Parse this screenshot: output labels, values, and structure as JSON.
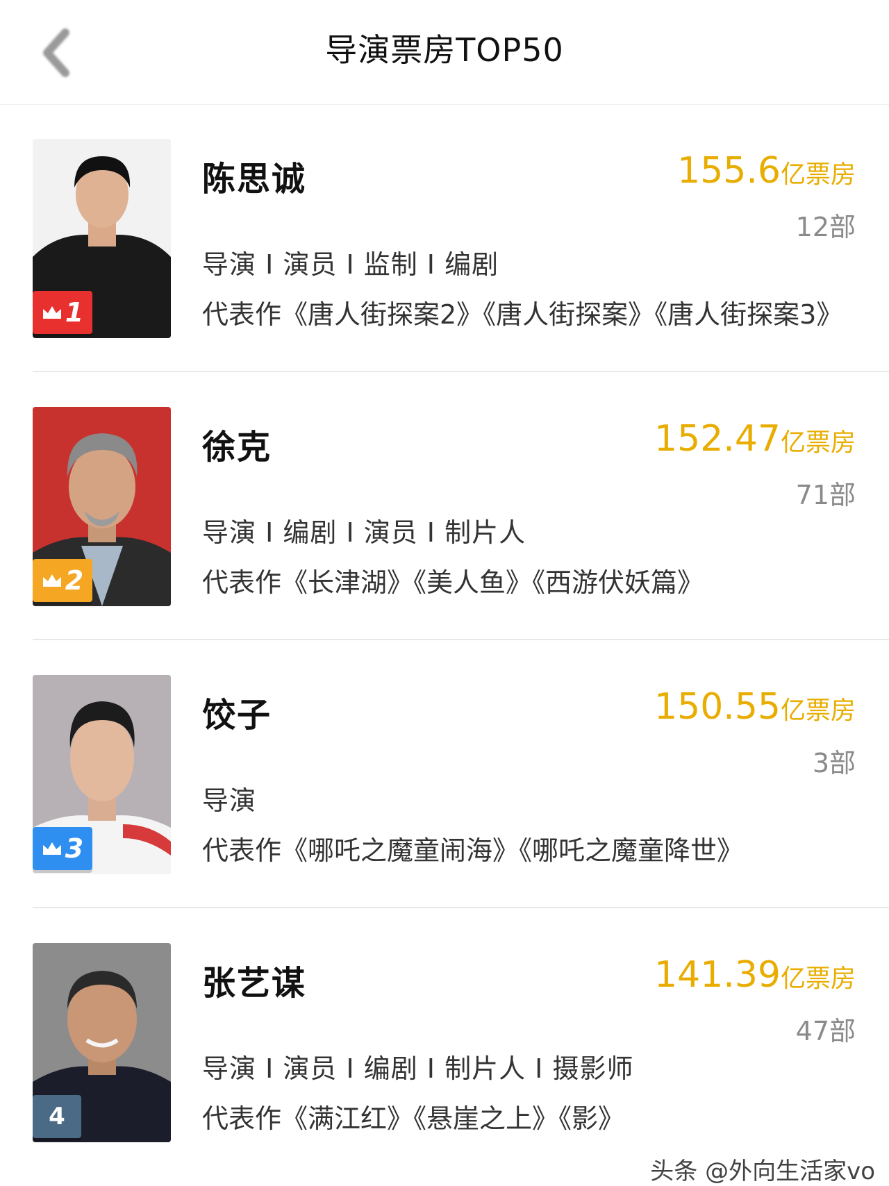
{
  "header": {
    "title": "导演票房TOP50"
  },
  "directors": [
    {
      "rank": "1",
      "name": "陈思诚",
      "box_office": "155.6",
      "box_office_unit": "亿票房",
      "film_count": "12部",
      "roles": "导演 I 演员 I 监制 I 编剧",
      "works": "代表作《唐人街探案2》《唐人街探案》《唐人街探案3》",
      "badge_color": "#e8312f"
    },
    {
      "rank": "2",
      "name": "徐克",
      "box_office": "152.47",
      "box_office_unit": "亿票房",
      "film_count": "71部",
      "roles": "导演 I 编剧 I 演员 I 制片人",
      "works": "代表作《长津湖》《美人鱼》《西游伏妖篇》",
      "badge_color": "#f5a623"
    },
    {
      "rank": "3",
      "name": "饺子",
      "box_office": "150.55",
      "box_office_unit": "亿票房",
      "film_count": "3部",
      "roles": "导演",
      "works": "代表作《哪吒之魔童闹海》《哪吒之魔童降世》",
      "badge_color": "#2f8ff0"
    },
    {
      "rank": "4",
      "name": "张艺谋",
      "box_office": "141.39",
      "box_office_unit": "亿票房",
      "film_count": "47部",
      "roles": "导演 I 演员 I 编剧 I 制片人 I 摄影师",
      "works": "代表作《满江红》《悬崖之上》《影》",
      "badge_color": "#4a6a86"
    }
  ],
  "watermark": "头条 @外向生活家vo",
  "colors": {
    "accent": "#e8ad00",
    "count": "#8a8a8a"
  }
}
